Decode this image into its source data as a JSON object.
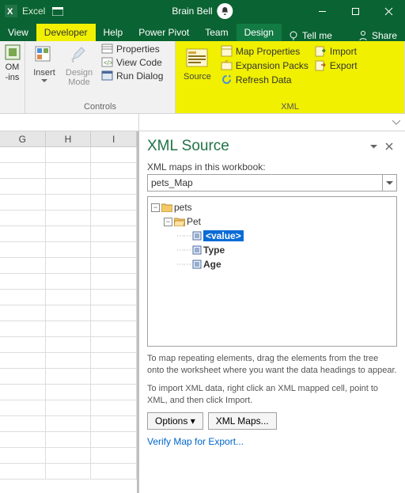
{
  "titlebar": {
    "app": "Excel",
    "document": "Brain Bell"
  },
  "tabs": {
    "view": "View",
    "developer": "Developer",
    "help": "Help",
    "powerpivot": "Power Pivot",
    "team": "Team",
    "design": "Design",
    "tellme": "Tell me",
    "share": "Share"
  },
  "ribbon": {
    "com_group": "-ins",
    "com_btn1": "OM",
    "insert": "Insert",
    "design_mode": "Design Mode",
    "properties": "Properties",
    "view_code": "View Code",
    "run_dialog": "Run Dialog",
    "controls_label": "Controls",
    "source": "Source",
    "map_properties": "Map Properties",
    "expansion_packs": "Expansion Packs",
    "refresh_data": "Refresh Data",
    "import": "Import",
    "export": "Export",
    "xml_label": "XML"
  },
  "cols": {
    "g": "G",
    "h": "H",
    "i": "I"
  },
  "pane": {
    "title": "XML Source",
    "maps_label": "XML maps in this workbook:",
    "map_name": "pets_Map",
    "tree": {
      "root": "pets",
      "child": "Pet",
      "value": "<value>",
      "type": "Type",
      "age": "Age"
    },
    "help1": "To map repeating elements, drag the elements from the tree onto the worksheet where you want the data headings to appear.",
    "help2": "To import XML data, right click an XML mapped cell, point to XML, and then click Import.",
    "options_btn": "Options",
    "xmlmaps_btn": "XML Maps...",
    "verify": "Verify Map for Export..."
  }
}
